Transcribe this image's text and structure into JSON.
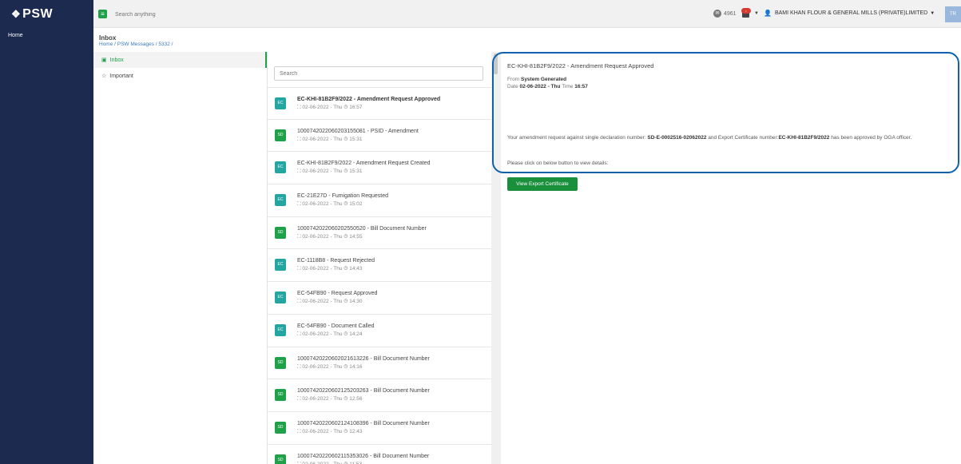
{
  "brand": {
    "logo_mark": "❖",
    "logo_text": "PSW"
  },
  "sidebar": {
    "home_label": "Home"
  },
  "header": {
    "menu_icon": "hamburger-icon",
    "search_placeholder": "Search anything",
    "notification_count": "4961",
    "user_name": "BAMI KHAN FLOUR & GENERAL MILLS (PRIVATE)LIMITED",
    "avatar_initials": "TR",
    "accent_color": "#1fa14a"
  },
  "page": {
    "title": "Inbox",
    "breadcrumb": "Home / PSW Messages / 5332 /"
  },
  "folders": [
    {
      "label": "Inbox",
      "icon": "inbox-icon"
    },
    {
      "label": "Important",
      "icon": "star-icon"
    }
  ],
  "list": {
    "search_placeholder": "Search",
    "items": [
      {
        "tag": "EC",
        "color": "#23a6a1",
        "subject": "EC-KHI-81B2F9/2022 - Amendment Request Approved",
        "meta": "⛶ 02-06-2022 - Thu  ◷ 16:57"
      },
      {
        "tag": "SD",
        "color": "#1fa14a",
        "subject": "1000742022060203155081 - PSID - Amendment",
        "meta": "⛶ 02-06-2022 - Thu  ◷ 15:31"
      },
      {
        "tag": "EC",
        "color": "#23a6a1",
        "subject": "EC-KHI-81B2F9/2022 - Amendment Request Created",
        "meta": "⛶ 02-06-2022 - Thu  ◷ 15:31"
      },
      {
        "tag": "EC",
        "color": "#23a6a1",
        "subject": "EC-21E27D - Fumigation Requested",
        "meta": "⛶ 02-06-2022 - Thu  ◷ 15:02"
      },
      {
        "tag": "SD",
        "color": "#1fa14a",
        "subject": "1000742022060202550520 - Bill Document Number",
        "meta": "⛶ 02-06-2022 - Thu  ◷ 14:55"
      },
      {
        "tag": "EC",
        "color": "#23a6a1",
        "subject": "EC-1118B8 - Request Rejected",
        "meta": "⛶ 02-06-2022 - Thu  ◷ 14:43"
      },
      {
        "tag": "EC",
        "color": "#23a6a1",
        "subject": "EC-54FB90 - Request Approved",
        "meta": "⛶ 02-06-2022 - Thu  ◷ 14:30"
      },
      {
        "tag": "EC",
        "color": "#23a6a1",
        "subject": "EC-54FB90 - Document Called",
        "meta": "⛶ 02-06-2022 - Thu  ◷ 14:24"
      },
      {
        "tag": "SD",
        "color": "#1fa14a",
        "subject": "1000742022060202161322​6 - Bill Document Number",
        "meta": "⛶ 02-06-2022 - Thu  ◷ 14:16"
      },
      {
        "tag": "SD",
        "color": "#1fa14a",
        "subject": "1000742022060212520326​3 - Bill Document Number",
        "meta": "⛶ 02-06-2022 - Thu  ◷ 12:56"
      },
      {
        "tag": "SD",
        "color": "#1fa14a",
        "subject": "1000742022060212410839​6 - Bill Document Number",
        "meta": "⛶ 02-06-2022 - Thu  ◷ 12:43"
      },
      {
        "tag": "SD",
        "color": "#1fa14a",
        "subject": "1000742022060211535302​6 - Bill Document Number",
        "meta": "⛶ 02-06-2022 - Thu  ◷ 11:53"
      }
    ]
  },
  "detail": {
    "title": "EC-KHI-81B2F9/2022 - Amendment Request Approved",
    "from_label": "From",
    "from_value": "System Generated",
    "date_label": "Date",
    "date_value": "02-06-2022 - Thu",
    "time_label": "Time",
    "time_value": "16:57",
    "body_part1": "Your amendment request against single declaration number: ",
    "body_sd": "SD-E-0002516-02062022",
    "body_part2": " and Export Certificate number:",
    "body_ec": "EC-KHI-81B2F9/2022",
    "body_part3": " has been approved by OGA officer.",
    "click_text": "Please click on below button to view details:",
    "button_label": "View Export Certificate"
  }
}
